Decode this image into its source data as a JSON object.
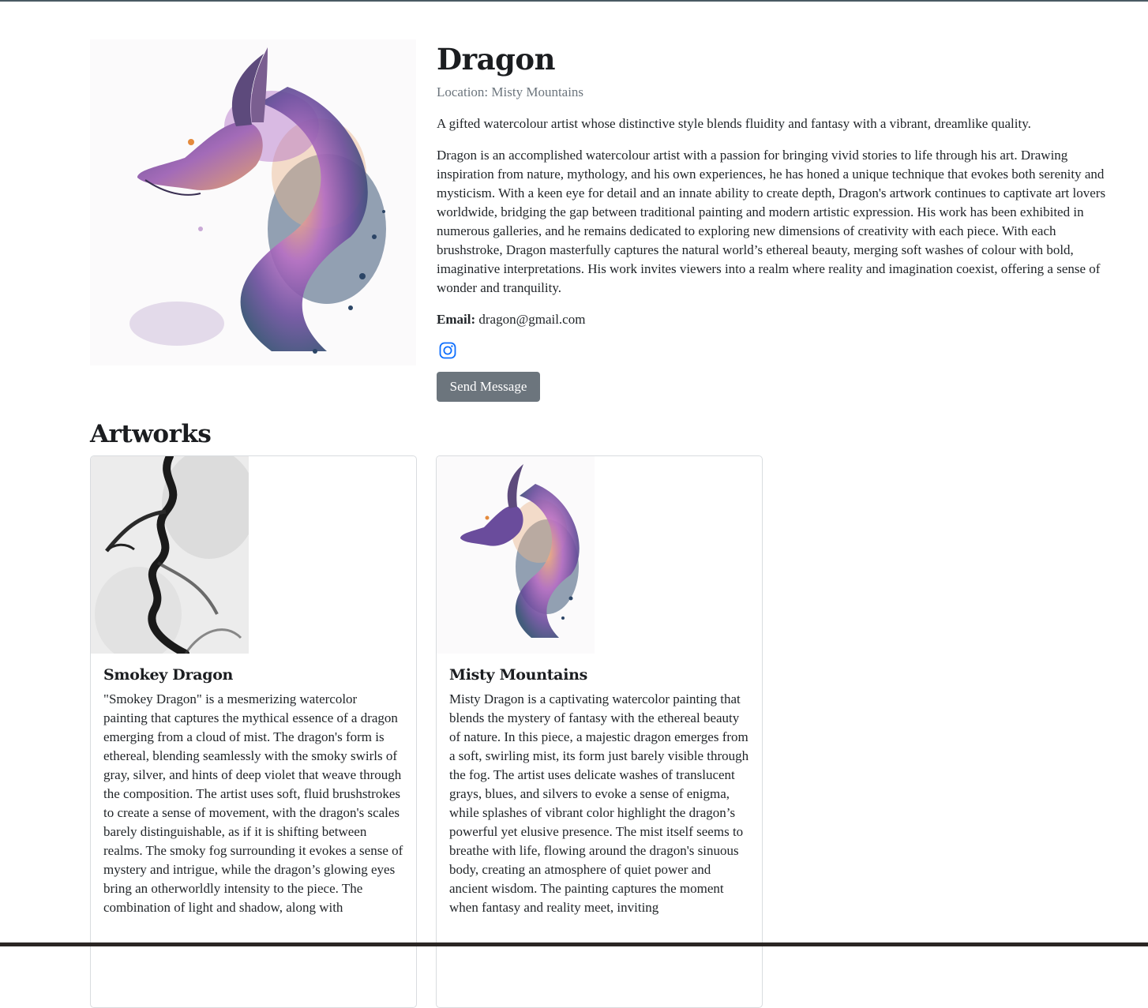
{
  "artist": {
    "name": "Dragon",
    "location": "Location: Misty Mountains",
    "tagline": "A gifted watercolour artist whose distinctive style blends fluidity and fantasy with a vibrant, dreamlike quality.",
    "bio": "Dragon is an accomplished watercolour artist with a passion for bringing vivid stories to life through his art. Drawing inspiration from nature, mythology, and his own experiences, he has honed a unique technique that evokes both serenity and mysticism. With a keen eye for detail and an innate ability to create depth, Dragon's artwork continues to captivate art lovers worldwide, bridging the gap between traditional painting and modern artistic expression. His work has been exhibited in numerous galleries, and he remains dedicated to exploring new dimensions of creativity with each piece. With each brushstroke, Dragon masterfully captures the natural world’s ethereal beauty, merging soft washes of colour with bold, imaginative interpretations. His work invites viewers into a realm where reality and imagination coexist, offering a sense of wonder and tranquility.",
    "email_label": "Email:",
    "email": "dragon@gmail.com",
    "social_icon": "instagram-icon",
    "send_button_label": "Send Message"
  },
  "artworks_section": {
    "title": "Artworks",
    "items": [
      {
        "title": "Smokey Dragon",
        "description": "\"Smokey Dragon\" is a mesmerizing watercolor painting that captures the mythical essence of a dragon emerging from a cloud of mist. The dragon's form is ethereal, blending seamlessly with the smoky swirls of gray, silver, and hints of deep violet that weave through the composition. The artist uses soft, fluid brushstrokes to create a sense of movement, with the dragon's scales barely distinguishable, as if it is shifting between realms. The smoky fog surrounding it evokes a sense of mystery and intrigue, while the dragon’s glowing eyes bring an otherworldly intensity to the piece. The combination of light and shadow, along with"
      },
      {
        "title": "Misty Mountains",
        "description": "Misty Dragon is a captivating watercolor painting that blends the mystery of fantasy with the ethereal beauty of nature. In this piece, a majestic dragon emerges from a soft, swirling mist, its form just barely visible through the fog. The artist uses delicate washes of translucent grays, blues, and silvers to evoke a sense of enigma, while splashes of vibrant color highlight the dragon’s powerful yet elusive presence. The mist itself seems to breathe with life, flowing around the dragon's sinuous body, creating an atmosphere of quiet power and ancient wisdom. The painting captures the moment when fantasy and reality meet, inviting"
      }
    ]
  },
  "colors": {
    "button_bg": "#6c757d",
    "social_icon": "#0d6efd",
    "muted_text": "#6c757d",
    "card_border": "#d9dcdf"
  }
}
